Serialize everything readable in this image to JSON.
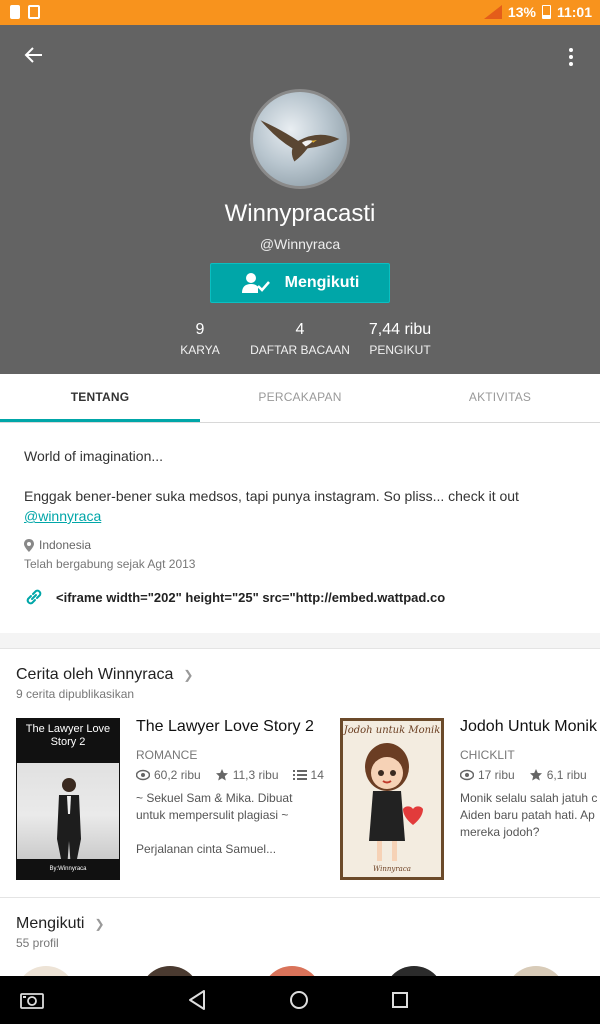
{
  "status_bar": {
    "battery": "13%",
    "time": "11:01"
  },
  "profile": {
    "name": "Winnypracasti",
    "handle": "@Winnyraca",
    "follow_label": "Mengikuti",
    "stats": [
      {
        "value": "9",
        "label": "KARYA"
      },
      {
        "value": "4",
        "label": "DAFTAR BACAAN"
      },
      {
        "value": "7,44 ribu",
        "label": "PENGIKUT"
      }
    ]
  },
  "tabs": [
    {
      "label": "TENTANG"
    },
    {
      "label": "PERCAKAPAN"
    },
    {
      "label": "AKTIVITAS"
    }
  ],
  "about": {
    "line1": "World of imagination...",
    "line2": "Enggak bener-bener suka medsos, tapi punya instagram. So pliss... check it out",
    "link": "@winnyraca",
    "location": "Indonesia",
    "joined": "Telah bergabung sejak Agt 2013",
    "website": "<iframe width=\"202\" height=\"25\" src=\"http://embed.wattpad.co"
  },
  "stories_section": {
    "title": "Cerita oleh Winnyraca",
    "subtitle": "9 cerita dipublikasikan",
    "stories": [
      {
        "cover_title": "The Lawyer Love Story 2",
        "cover_author": "By:Winnyraca",
        "title": "The Lawyer Love Story 2",
        "genre": "ROMANCE",
        "reads": "60,2 ribu",
        "votes": "11,3 ribu",
        "parts": "14",
        "desc_lines": [
          "~ Sekuel Sam & Mika. Dibuat",
          "untuk mempersulit plagiasi ~",
          "",
          "Perjalanan cinta Samuel..."
        ]
      },
      {
        "cover_title": "Jodoh untuk Monik",
        "cover_author": "Winnyraca",
        "title": "Jodoh Untuk Monik",
        "genre": "CHICKLIT",
        "reads": "17 ribu",
        "votes": "6,1 ribu",
        "parts": "",
        "desc_lines": [
          "Monik selalu salah jatuh c",
          "Aiden  baru patah hati. Ap",
          "mereka jodoh?"
        ]
      }
    ]
  },
  "following_section": {
    "title": "Mengikuti",
    "subtitle": "55 profil"
  },
  "colors": {
    "accent": "#00a6a8",
    "status_bar": "#f8931d",
    "header": "#636363"
  }
}
